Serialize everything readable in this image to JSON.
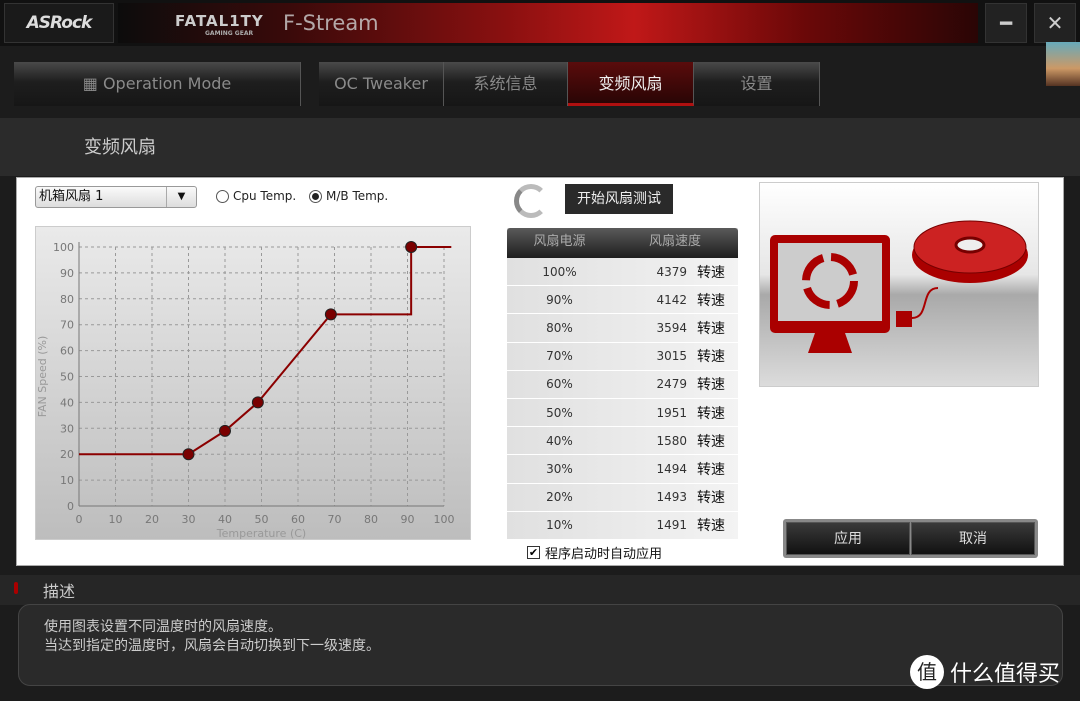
{
  "titlebar": {
    "brand": "ASRock",
    "banner_logo": "FATAL1TY",
    "banner_sub": "GAMING GEAR",
    "app_title": "F-Stream",
    "minimize_icon": "minimize-icon",
    "close_icon": "close-icon"
  },
  "tabs": [
    {
      "label": "Operation Mode",
      "icon": "grid-icon"
    },
    {
      "label": "OC Tweaker"
    },
    {
      "label": "系统信息"
    },
    {
      "label": "变频风扇",
      "active": true
    },
    {
      "label": "设置"
    }
  ],
  "page": {
    "title": "变频风扇"
  },
  "controls": {
    "fan_select": "机箱风扇 1",
    "radio_cpu": "Cpu Temp.",
    "radio_mb": "M/B Temp.",
    "selected_source": "M/B Temp.",
    "test_button": "开始风扇测试"
  },
  "table": {
    "headers": [
      "风扇电源",
      "风扇速度"
    ],
    "unit": "转速",
    "rows": [
      {
        "power": "100%",
        "speed": "4379"
      },
      {
        "power": "90%",
        "speed": "4142"
      },
      {
        "power": "80%",
        "speed": "3594"
      },
      {
        "power": "70%",
        "speed": "3015"
      },
      {
        "power": "60%",
        "speed": "2479"
      },
      {
        "power": "50%",
        "speed": "1951"
      },
      {
        "power": "40%",
        "speed": "1580"
      },
      {
        "power": "30%",
        "speed": "1494"
      },
      {
        "power": "20%",
        "speed": "1493"
      },
      {
        "power": "10%",
        "speed": "1491"
      }
    ]
  },
  "auto_apply": {
    "label": "程序启动时自动应用",
    "checked": true
  },
  "buttons": {
    "apply": "应用",
    "cancel": "取消"
  },
  "description": {
    "title": "描述",
    "lines": [
      "使用图表设置不同温度时的风扇速度。",
      "当达到指定的温度时，风扇会自动切换到下一级速度。"
    ]
  },
  "watermark": {
    "icon": "值",
    "text": "什么值得买"
  },
  "colors": {
    "accent": "#8b0000",
    "active_tab": "#5a0c0c"
  },
  "chart_data": {
    "type": "line",
    "xlabel": "Temperature (C)",
    "ylabel": "FAN Speed (%)",
    "xlim": [
      0,
      100
    ],
    "ylim": [
      0,
      100
    ],
    "xticks": [
      0,
      10,
      20,
      30,
      40,
      50,
      60,
      70,
      80,
      90,
      100
    ],
    "yticks": [
      0,
      10,
      20,
      30,
      40,
      50,
      60,
      70,
      80,
      90,
      100
    ],
    "grid": true,
    "control_points": [
      [
        30,
        20
      ],
      [
        40,
        29
      ],
      [
        49,
        40
      ],
      [
        69,
        74
      ],
      [
        91,
        100
      ]
    ],
    "curve": [
      [
        0,
        20
      ],
      [
        30,
        20
      ],
      [
        40,
        29
      ],
      [
        49,
        40
      ],
      [
        69,
        74
      ],
      [
        91,
        74
      ],
      [
        91,
        100
      ],
      [
        102,
        100
      ]
    ]
  }
}
